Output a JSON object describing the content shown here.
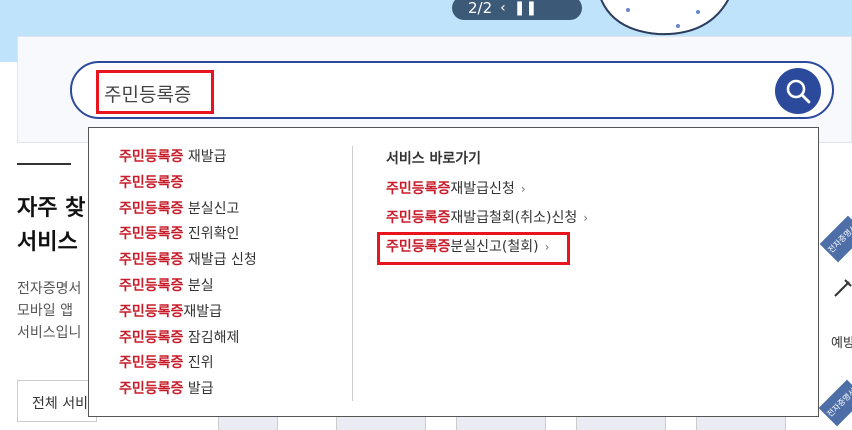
{
  "pager": {
    "text": "2/2",
    "prev_icon": "chevron-left-icon",
    "pause_icon": "pause-icon"
  },
  "search": {
    "value": "주민등록증",
    "button_icon": "search-icon"
  },
  "faq": {
    "title_line1": "자주 찾",
    "title_line2": "서비스",
    "desc_line1": "전자증명서",
    "desc_line2": "모바일 앱",
    "desc_line3": "서비스입니",
    "all_services": "전체 서비"
  },
  "suggestions": [
    {
      "keyword": "주민등록증",
      "rest": " 재발급"
    },
    {
      "keyword": "주민등록증",
      "rest": ""
    },
    {
      "keyword": "주민등록증",
      "rest": " 분실신고"
    },
    {
      "keyword": "주민등록증",
      "rest": " 진위확인"
    },
    {
      "keyword": "주민등록증",
      "rest": " 재발급 신청"
    },
    {
      "keyword": "주민등록증",
      "rest": " 분실"
    },
    {
      "keyword": "주민등록증",
      "rest": "재발급"
    },
    {
      "keyword": "주민등록증",
      "rest": " 잠김해제"
    },
    {
      "keyword": "주민등록증",
      "rest": " 진위"
    },
    {
      "keyword": "주민등록증",
      "rest": " 발급"
    }
  ],
  "shortcuts": {
    "title": "서비스 바로가기",
    "items": [
      {
        "keyword": "주민등록증",
        "rest": "재발급신청"
      },
      {
        "keyword": "주민등록증",
        "rest": "재발급철회(취소)신청"
      },
      {
        "keyword": "주민등록증",
        "rest": "분실신고(철회)"
      }
    ]
  },
  "right_card": {
    "ribbon": "전자증명서",
    "label": "예방"
  },
  "colors": {
    "accent": "#2b4a9c",
    "highlight": "#e8141e",
    "keyword": "#c81c2a"
  }
}
